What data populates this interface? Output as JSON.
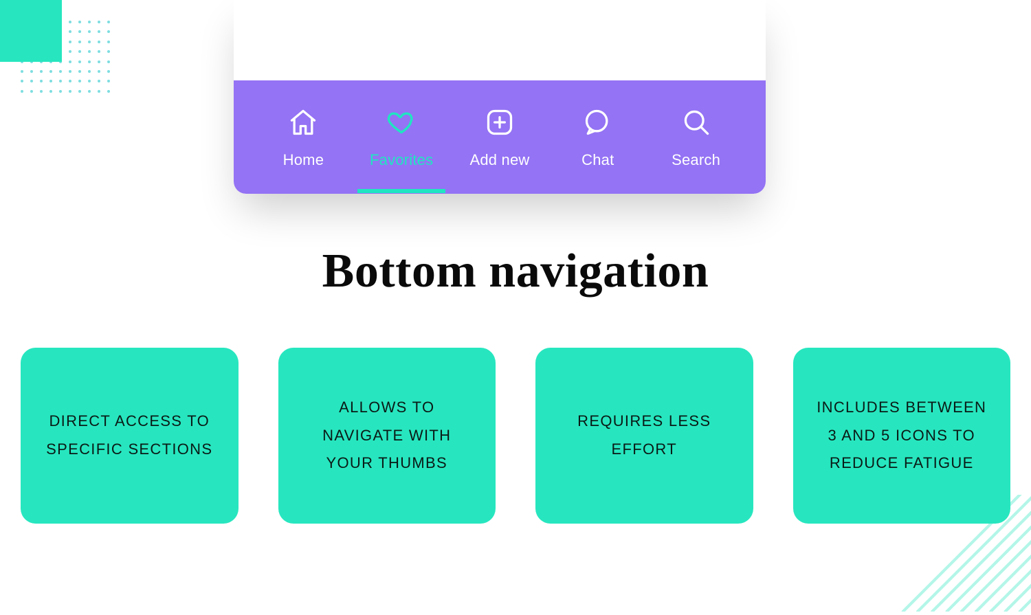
{
  "colors": {
    "accent_teal": "#27e6bf",
    "nav_bg": "#9473f4",
    "nav_fg": "#ffffff",
    "nav_active": "#1fe6c1",
    "text_dark": "#0a0a0a"
  },
  "nav": {
    "items": [
      {
        "label": "Home",
        "icon": "home-icon",
        "active": false
      },
      {
        "label": "Favorites",
        "icon": "heart-icon",
        "active": true
      },
      {
        "label": "Add new",
        "icon": "add-icon",
        "active": false
      },
      {
        "label": "Chat",
        "icon": "chat-icon",
        "active": false
      },
      {
        "label": "Search",
        "icon": "search-icon",
        "active": false
      }
    ]
  },
  "title": "Bottom navigation",
  "cards": [
    "Direct access to specific sections",
    "Allows to navigate with your thumbs",
    "Requires less effort",
    "Includes between 3 and 5 icons to reduce fatigue"
  ]
}
